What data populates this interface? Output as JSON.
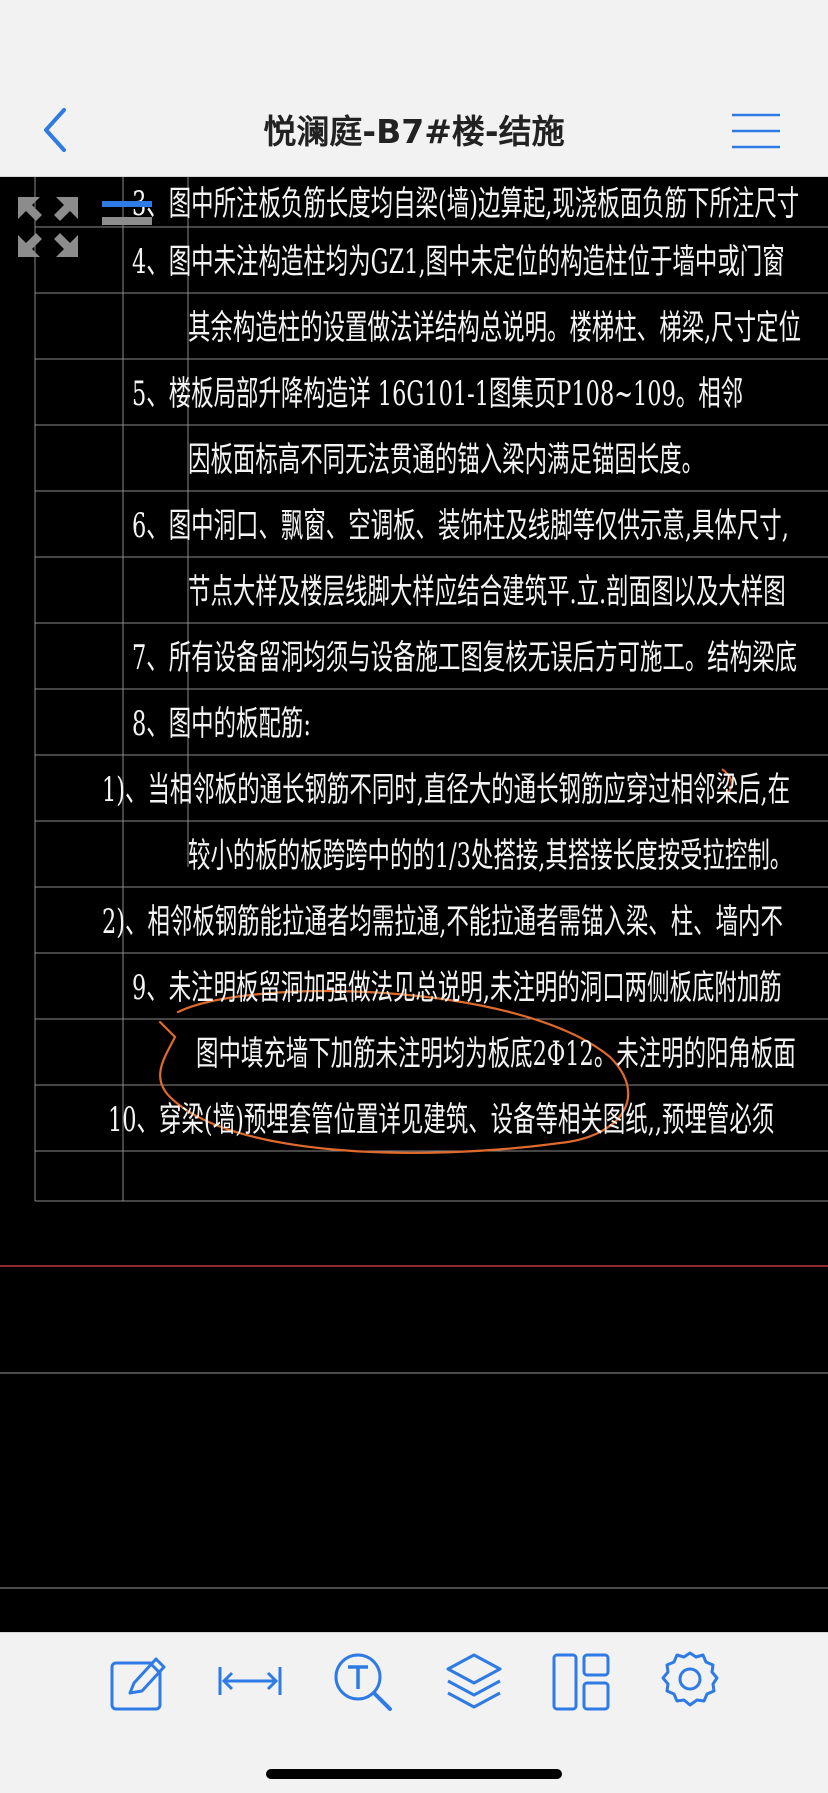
{
  "header": {
    "title": "悦澜庭-B7#楼-结施",
    "back_icon": "chevron-left-icon",
    "menu_icon": "hamburger-menu-icon"
  },
  "colors": {
    "accent": "#2f7be5",
    "bar_background": "#f2f2f2",
    "drawing_background": "#000000",
    "drawing_text": "#f4f4f4",
    "grid_line": "#8a8a8a",
    "markup": "#e06a2c",
    "red_line": "#c0393b"
  },
  "drawing": {
    "lines": [
      "3、图中所注板负筋长度均自梁(墙)边算起,现浇板面负筋下所注尺寸",
      "4、图中未注构造柱均为GZ1,图中未定位的构造柱位于墙中或门窗",
      "其余构造柱的设置做法详结构总说明。楼梯柱、梯梁,尺寸定位",
      "5、楼板局部升降构造详 16G101-1图集页P108~109。相邻",
      "因板面标高不同无法贯通的锚入梁内满足锚固长度。",
      "6、图中洞口、飘窗、空调板、装饰柱及线脚等仅供示意,具体尺寸,",
      "节点大样及楼层线脚大样应结合建筑平.立.剖面图以及大样图",
      "7、所有设备留洞均须与设备施工图复核无误后方可施工。结构梁底",
      "8、图中的板配筋:",
      "1)、当相邻板的通长钢筋不同时,直径大的通长钢筋应穿过相邻梁后,在",
      "较小的板的板跨跨中的的1/3处搭接,其搭接长度按受拉控制。",
      "2)、相邻板钢筋能拉通者均需拉通,不能拉通者需锚入梁、柱、墙内不",
      "9、未注明板留洞加强做法见总说明,未注明的洞口两侧板底附加筋",
      "图中填充墙下加筋未注明均为板底2Φ12。未注明的阳角板面",
      "10、穿梁(墙)预埋套管位置详见建筑、设备等相关图纸,,预埋管必须"
    ]
  },
  "overlay": {
    "fit_icon": "fit-screen-icon",
    "layer_icon": "layer-toggle-icon"
  },
  "toolbar": {
    "tools": [
      "annotate-edit-icon",
      "measure-distance-icon",
      "text-search-icon",
      "layers-icon",
      "layout-panels-icon",
      "settings-gear-icon"
    ]
  }
}
